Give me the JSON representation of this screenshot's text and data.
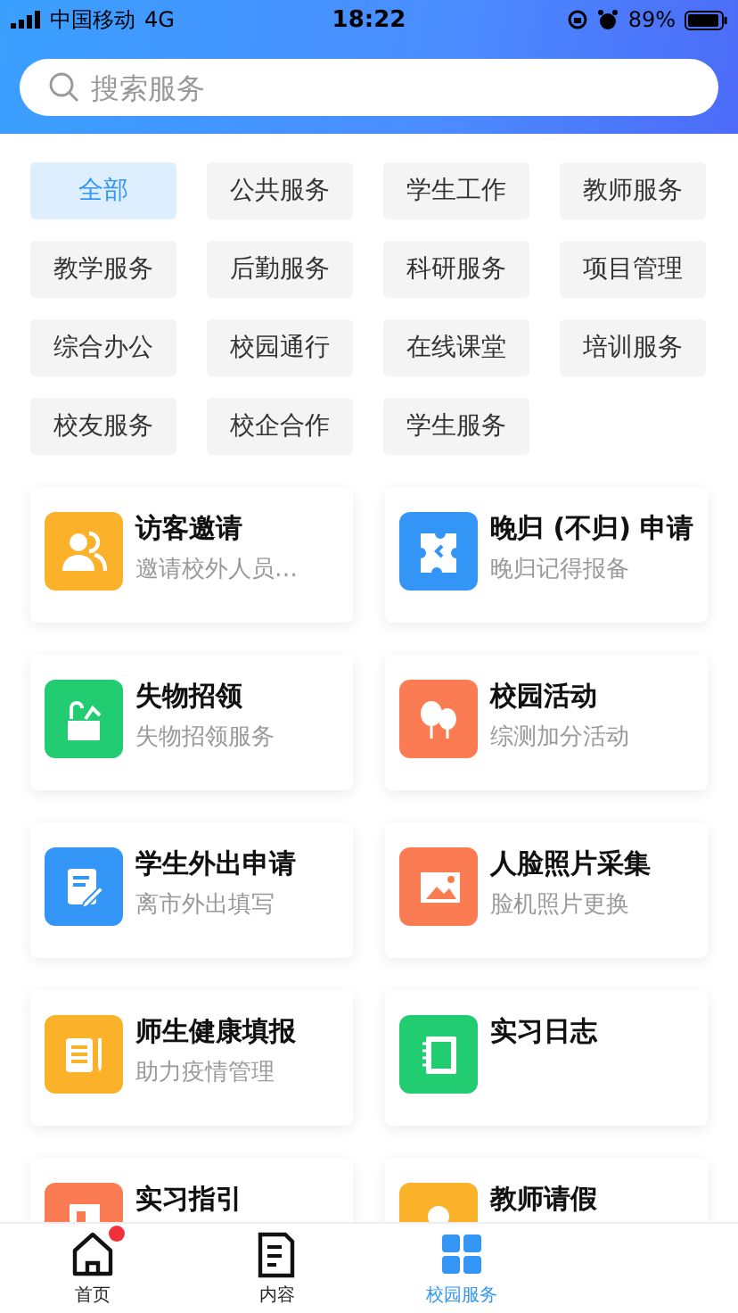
{
  "status_bar": {
    "carrier": "中国移动",
    "network": "4G",
    "time": "18:22",
    "battery": "89%"
  },
  "search": {
    "placeholder": "搜索服务"
  },
  "categories": [
    {
      "label": "全部",
      "selected": true
    },
    {
      "label": "公共服务",
      "selected": false
    },
    {
      "label": "学生工作",
      "selected": false
    },
    {
      "label": "教师服务",
      "selected": false
    },
    {
      "label": "教学服务",
      "selected": false
    },
    {
      "label": "后勤服务",
      "selected": false
    },
    {
      "label": "科研服务",
      "selected": false
    },
    {
      "label": "项目管理",
      "selected": false
    },
    {
      "label": "综合办公",
      "selected": false
    },
    {
      "label": "校园通行",
      "selected": false
    },
    {
      "label": "在线课堂",
      "selected": false
    },
    {
      "label": "培训服务",
      "selected": false
    },
    {
      "label": "校友服务",
      "selected": false
    },
    {
      "label": "校企合作",
      "selected": false
    },
    {
      "label": "学生服务",
      "selected": false
    }
  ],
  "services": [
    {
      "title": "访客邀请",
      "subtitle": "邀请校外人员…",
      "kind": "people",
      "color": "#fbb22a"
    },
    {
      "title": "晚归 (不归) 申请",
      "subtitle": "晚归记得报备",
      "kind": "puzzle",
      "color": "#3396f7"
    },
    {
      "title": "失物招领",
      "subtitle": "失物招领服务",
      "kind": "box",
      "color": "#22cc70"
    },
    {
      "title": "校园活动",
      "subtitle": "综测加分活动",
      "kind": "balloon",
      "color": "#fb7b52"
    },
    {
      "title": "学生外出申请",
      "subtitle": "离市外出填写",
      "kind": "edit",
      "color": "#3396f7"
    },
    {
      "title": "人脸照片采集",
      "subtitle": "脸机照片更换",
      "kind": "image",
      "color": "#fb7b52"
    },
    {
      "title": "师生健康填报",
      "subtitle": "助力疫情管理",
      "kind": "form",
      "color": "#fbb22a"
    },
    {
      "title": "实习日志",
      "kind": "notebook",
      "color": "#22cc70"
    },
    {
      "title": "实习指引",
      "kind": "door",
      "color": "#fb7b52"
    },
    {
      "title": "教师请假",
      "kind": "person",
      "color": "#fbb22a"
    }
  ],
  "tab_bar": [
    {
      "label": "首页",
      "kind": "home",
      "selected": false,
      "badge": true
    },
    {
      "label": "内容",
      "kind": "doc",
      "selected": false,
      "badge": false
    },
    {
      "label": "校园服务",
      "kind": "grid",
      "selected": true,
      "badge": false
    }
  ]
}
